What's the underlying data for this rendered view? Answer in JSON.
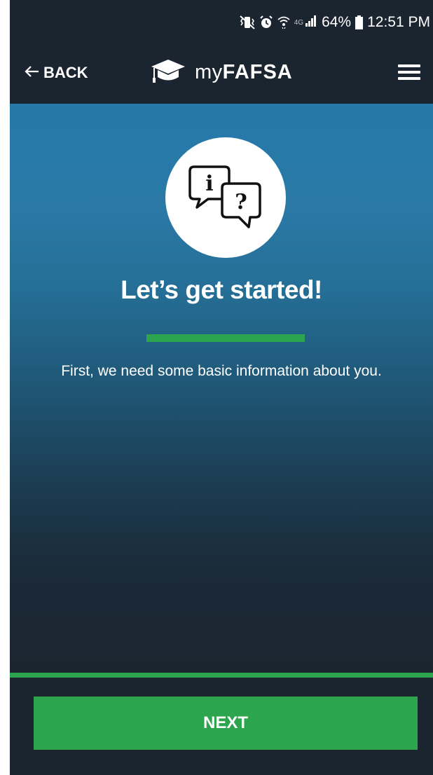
{
  "status_bar": {
    "battery": "64%",
    "time": "12:51 PM",
    "network": "4G",
    "icons": [
      "vibrate-icon",
      "alarm-icon",
      "wifi-icon",
      "signal-icon",
      "battery-icon"
    ]
  },
  "header": {
    "back_label": "BACK",
    "back_icon": "arrow-left-icon",
    "brand_prefix": "my",
    "brand_bold": "FAFSA",
    "brand_icon": "graduation-cap-icon",
    "menu_icon": "hamburger-menu-icon"
  },
  "main": {
    "hero_icon": "info-question-chat-bubbles-icon",
    "heading": "Let’s get started!",
    "subtext": "First, we need some basic information about you."
  },
  "footer": {
    "next_label": "NEXT"
  },
  "colors": {
    "bar_background": "#1b2530",
    "accent_green": "#2da44e",
    "gradient_top": "#2479a9"
  }
}
